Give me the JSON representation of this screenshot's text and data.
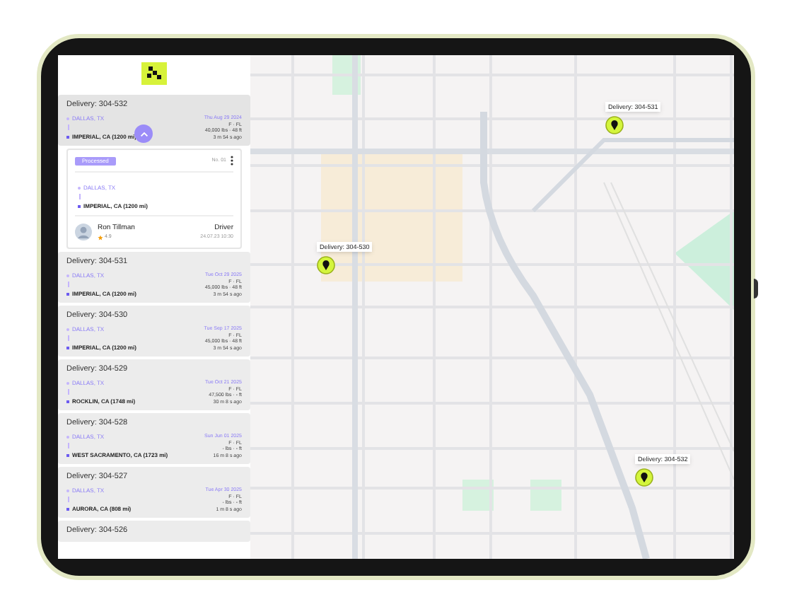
{
  "deliveries": [
    {
      "title": "Delivery: 304-532",
      "origin": "DALLAS, TX",
      "destination": "IMPERIAL, CA (1200 mi)",
      "date": "Thu Aug 29 2024",
      "trailer": "F · FL",
      "load": "40,000 lbs · 48 ft",
      "age": "3 m 54 s ago",
      "expanded": true,
      "details": {
        "status": "Processed",
        "number": "No. 01",
        "origin": "DALLAS, TX",
        "destination": "IMPERIAL, CA (1200 mi)",
        "driver": "Ron Tillman",
        "rating": "4.9",
        "role": "Driver",
        "time": "24.07.23 10:30"
      }
    },
    {
      "title": "Delivery: 304-531",
      "origin": "DALLAS, TX",
      "destination": "IMPERIAL, CA (1200 mi)",
      "date": "Tue Oct 29 2025",
      "trailer": "F · FL",
      "load": "45,000 lbs · 48 ft",
      "age": "3 m 54 s ago",
      "expanded": false
    },
    {
      "title": "Delivery: 304-530",
      "origin": "DALLAS, TX",
      "destination": "IMPERIAL, CA (1200 mi)",
      "date": "Tue Sep 17 2025",
      "trailer": "F · FL",
      "load": "45,000 lbs · 48 ft",
      "age": "3 m 54 s ago",
      "expanded": false
    },
    {
      "title": "Delivery: 304-529",
      "origin": "DALLAS, TX",
      "destination": "ROCKLIN, CA (1748 mi)",
      "date": "Tue Oct 21 2025",
      "trailer": "F · FL",
      "load": "47,500 lbs · - ft",
      "age": "30 m 8 s ago",
      "expanded": false
    },
    {
      "title": "Delivery: 304-528",
      "origin": "DALLAS, TX",
      "destination": "WEST SACRAMENTO, CA (1723 mi)",
      "date": "Sun Jun 01 2025",
      "trailer": "F · FL",
      "load": "- lbs · - ft",
      "age": "16 m 8 s ago",
      "expanded": false
    },
    {
      "title": "Delivery: 304-527",
      "origin": "DALLAS, TX",
      "destination": "AURORA, CA (808 mi)",
      "date": "Tue Apr 30 2025",
      "trailer": "F · FL",
      "load": "- lbs · - ft",
      "age": "1 m 8 s ago",
      "expanded": false
    },
    {
      "title": "Delivery: 304-526",
      "expanded": false
    }
  ],
  "map": {
    "markers": [
      {
        "label": "Delivery: 304-531"
      },
      {
        "label": "Delivery: 304-530"
      },
      {
        "label": "Delivery: 304-532"
      }
    ]
  }
}
